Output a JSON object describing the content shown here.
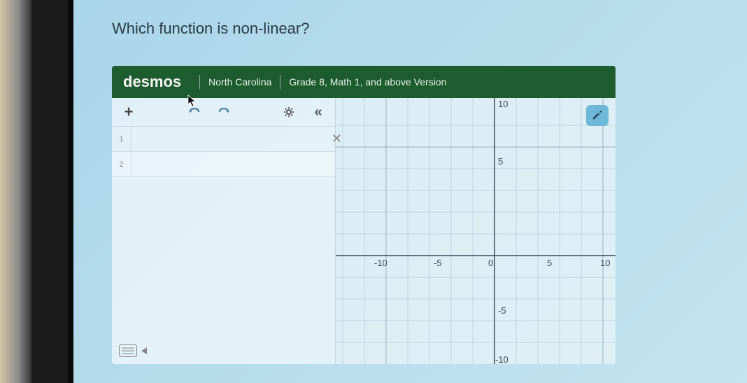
{
  "question": "Which function is non-linear?",
  "header": {
    "logo": "desmos",
    "region": "North Carolina",
    "version": "Grade 8, Math 1, and above Version"
  },
  "toolbar": {
    "add": "+",
    "undo": "↶",
    "redo": "↷",
    "settings": "⚙",
    "collapse": "«"
  },
  "expressions": {
    "row1_num": "1",
    "row2_num": "2",
    "close": "✕"
  },
  "graph": {
    "wrench": "🔧",
    "labels": {
      "y_pos10": "10",
      "y_pos5": "5",
      "y_neg5": "-5",
      "y_neg10": "-10",
      "x_neg10": "-10",
      "x_neg5": "-5",
      "x_zero": "0",
      "x_pos5": "5",
      "x_pos10": "10"
    }
  },
  "chart_data": {
    "type": "cartesian-plane",
    "xlim": [
      -12,
      12
    ],
    "ylim": [
      -12,
      12
    ],
    "x_ticks": [
      -10,
      -5,
      0,
      5,
      10
    ],
    "y_ticks": [
      -10,
      -5,
      5,
      10
    ],
    "series": []
  }
}
